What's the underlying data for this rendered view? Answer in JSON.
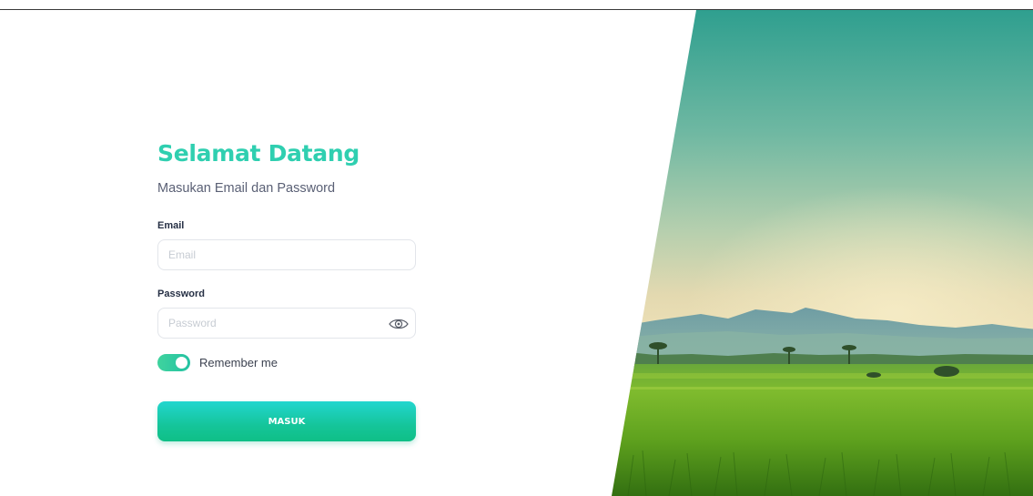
{
  "login": {
    "title": "Selamat Datang",
    "subtitle": "Masukan Email dan Password",
    "email": {
      "label": "Email",
      "placeholder": "Email",
      "value": ""
    },
    "password": {
      "label": "Password",
      "placeholder": "Password",
      "value": ""
    },
    "remember": {
      "label": "Remember me",
      "checked": true
    },
    "submit_label": "MASUK"
  },
  "colors": {
    "accent": "#2fcfb0",
    "button_gradient_start": "#22d6cf",
    "button_gradient_end": "#0fbf86",
    "toggle": "#2dc9a2"
  },
  "icons": {
    "password_toggle": "eye-icon"
  }
}
